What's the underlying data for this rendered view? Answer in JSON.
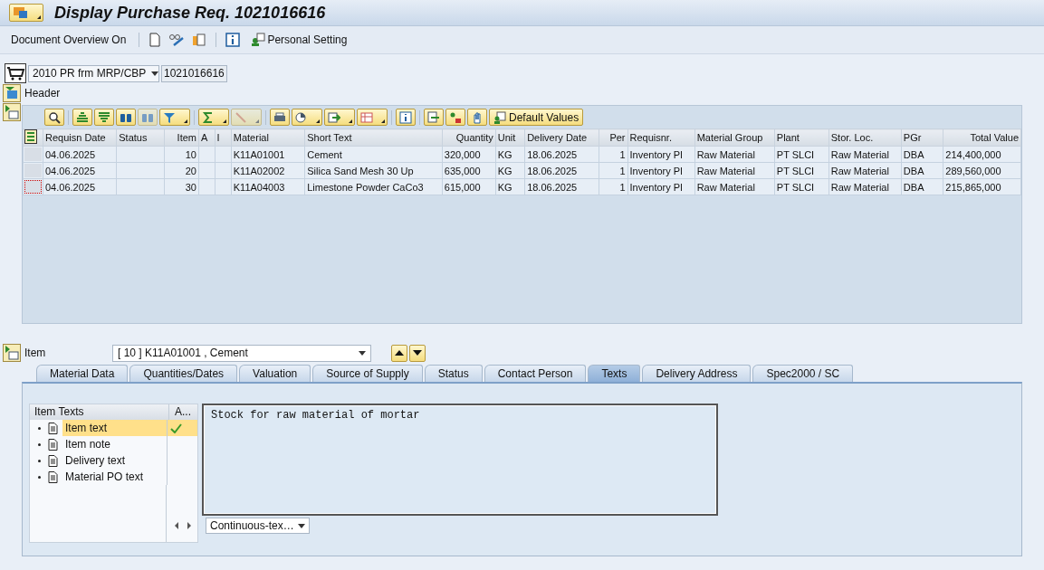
{
  "window": {
    "title": "Display Purchase Req. 1021016616"
  },
  "toolbar": {
    "overview": "Document Overview On",
    "personal": "Personal Setting"
  },
  "document": {
    "type": "2010 PR frm MRP/CBP",
    "number": "1021016616"
  },
  "header": {
    "label": "Header"
  },
  "grid": {
    "default_values": "Default Values",
    "columns": [
      "Requisn Date",
      "Status",
      "Item",
      "A",
      "I",
      "Material",
      "Short Text",
      "Quantity",
      "Unit",
      "Delivery Date",
      "Per",
      "Requisnr.",
      "Material Group",
      "Plant",
      "Stor. Loc.",
      "PGr",
      "Total Value"
    ],
    "rows": [
      {
        "focused": false,
        "cells": [
          "04.06.2025",
          "",
          "10",
          "",
          "",
          "K11A01001",
          "Cement",
          "320,000",
          "KG",
          "18.06.2025",
          "1",
          "Inventory Pl",
          "Raw Material",
          "PT SLCI",
          "Raw Material",
          "DBA",
          "214,400,000"
        ]
      },
      {
        "focused": false,
        "cells": [
          "04.06.2025",
          "",
          "20",
          "",
          "",
          "K11A02002",
          "Silica Sand Mesh 30 Up",
          "635,000",
          "KG",
          "18.06.2025",
          "1",
          "Inventory Pl",
          "Raw Material",
          "PT SLCI",
          "Raw Material",
          "DBA",
          "289,560,000"
        ]
      },
      {
        "focused": true,
        "cells": [
          "04.06.2025",
          "",
          "30",
          "",
          "",
          "K11A04003",
          "Limestone Powder CaCo3",
          "615,000",
          "KG",
          "18.06.2025",
          "1",
          "Inventory Pl",
          "Raw Material",
          "PT SLCI",
          "Raw Material",
          "DBA",
          "215,865,000"
        ]
      }
    ]
  },
  "item": {
    "label": "Item",
    "value": "[ 10 ] K11A01001 , Cement"
  },
  "tabs": [
    {
      "label": "Material Data",
      "selected": false
    },
    {
      "label": "Quantities/Dates",
      "selected": false
    },
    {
      "label": "Valuation",
      "selected": false
    },
    {
      "label": "Source of Supply",
      "selected": false
    },
    {
      "label": "Status",
      "selected": false
    },
    {
      "label": "Contact Person",
      "selected": false
    },
    {
      "label": "Texts",
      "selected": true
    },
    {
      "label": "Delivery Address",
      "selected": false
    },
    {
      "label": "Spec2000 / SC",
      "selected": false
    }
  ],
  "texts": {
    "tree_header": "Item Texts",
    "status_header": "A...",
    "items": [
      {
        "label": "Item text",
        "selected": true,
        "active": true
      },
      {
        "label": "Item note",
        "selected": false,
        "active": false
      },
      {
        "label": "Delivery text",
        "selected": false,
        "active": false
      },
      {
        "label": "Material PO text",
        "selected": false,
        "active": false
      }
    ],
    "editor_text": "Stock for raw material of mortar",
    "format": "Continuous-tex…"
  }
}
